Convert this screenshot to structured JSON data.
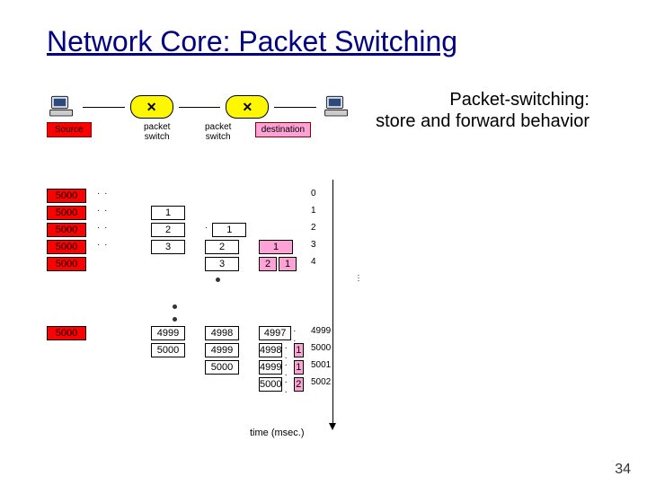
{
  "title": "Network Core: Packet Switching",
  "subtitle1": "Packet-switching:",
  "subtitle2": "store and forward behavior",
  "page_number": "34",
  "top": {
    "source_label": "Source",
    "packet_switch_label": "packet\nswitch",
    "destination_label": "destination",
    "x_symbol": "✕"
  },
  "grid": {
    "axis_top": [
      "0",
      "1",
      "2",
      "3",
      "4"
    ],
    "c1_top": [
      "1",
      "2",
      "3"
    ],
    "c2_top": [
      "",
      "1",
      "2",
      "3"
    ],
    "c3_top": [
      "",
      "",
      "1",
      "2"
    ],
    "c4_top": [
      "",
      "",
      "",
      "1"
    ],
    "redsrc_top": [
      "5000",
      "5000",
      "5000",
      "5000",
      "5000"
    ],
    "redsrc_bot": "5000",
    "c1_bot": [
      "4999",
      "5000"
    ],
    "c2_bot": [
      "4998",
      "4999",
      "5000"
    ],
    "c3_bot": [
      "4997",
      "4998",
      "4999",
      "5000"
    ],
    "c4_bot": [
      "",
      "",
      "",
      "2"
    ],
    "axis_bot": [
      "4999",
      "5000",
      "5001",
      "5002"
    ],
    "time_label": "time  (msec.)"
  }
}
